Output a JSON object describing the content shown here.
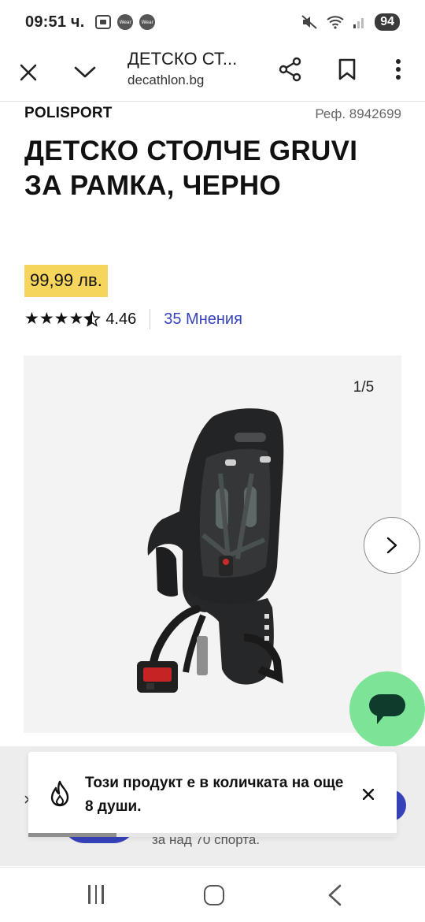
{
  "status_bar": {
    "time": "09:51 ч.",
    "wear_label_1": "Wear",
    "wear_label_2": "Wear",
    "battery": "94"
  },
  "toolbar": {
    "title": "ДЕТСКО СТ...",
    "domain": "decathlon.bg",
    "icons": [
      "close-icon",
      "chevron-down-icon",
      "share-icon",
      "bookmark-icon",
      "more-vert-icon"
    ]
  },
  "product": {
    "brand": "POLISPORT",
    "ref": "Реф. 8942699",
    "title": "ДЕТСКО СТОЛЧЕ GRUVI ЗА РАМКА, ЧЕРНО",
    "price": "99,99 лв.",
    "rating": {
      "value": "4.46",
      "stars": 4.5,
      "reviews_label": "35 Мнения"
    }
  },
  "gallery": {
    "counter": "1/5",
    "image_alt_icon": "bike-child-seat-image"
  },
  "toast": {
    "message": "Този продукт е в количката на още 8 души.",
    "progress": 0.24
  },
  "under_banner": {
    "close": "×",
    "text": "за над 70 спорта."
  },
  "colors": {
    "price_bg": "#f5d55c",
    "link": "#3643ba",
    "chat_fab": "#7de397"
  }
}
